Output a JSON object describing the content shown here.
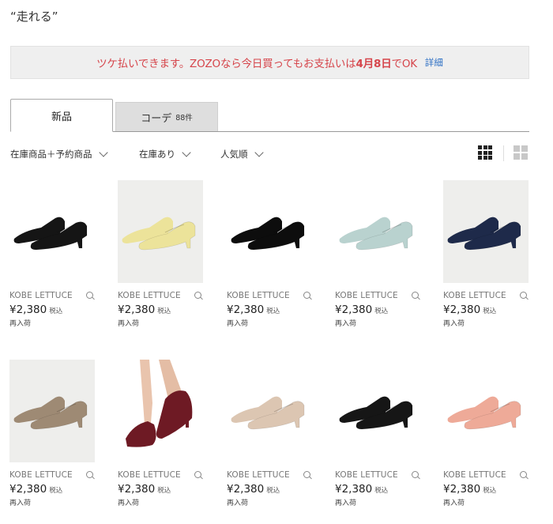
{
  "search": {
    "query": "“走れる”"
  },
  "banner": {
    "message_pre": "ツケ払いできます。ZOZOなら今日買ってもお支払いは",
    "message_bold": "4月8日",
    "message_post": "でOK",
    "more_link": "詳細"
  },
  "tabs": [
    {
      "label": "新品",
      "count": ""
    },
    {
      "label": "コーデ",
      "count": "88件"
    }
  ],
  "filters": {
    "stock_type": "在庫商品＋予約商品",
    "availability": "在庫あり",
    "sort": "人気順"
  },
  "view_icons": [
    "grid-3col-icon",
    "grid-2col-icon"
  ],
  "products": [
    {
      "brand": "KOBE LETTUCE",
      "price": "¥2,380",
      "tax": "税込",
      "note": "再入荷",
      "color": "#151515",
      "bg": "white"
    },
    {
      "brand": "KOBE LETTUCE",
      "price": "¥2,380",
      "tax": "税込",
      "note": "再入荷",
      "color": "#ece39a",
      "bg": "grey"
    },
    {
      "brand": "KOBE LETTUCE",
      "price": "¥2,380",
      "tax": "税込",
      "note": "再入荷",
      "color": "#0d0d0d",
      "bg": "white"
    },
    {
      "brand": "KOBE LETTUCE",
      "price": "¥2,380",
      "tax": "税込",
      "note": "再入荷",
      "color": "#b9d2cf",
      "bg": "white"
    },
    {
      "brand": "KOBE LETTUCE",
      "price": "¥2,380",
      "tax": "税込",
      "note": "再入荷",
      "color": "#1e2a4a",
      "bg": "grey"
    },
    {
      "brand": "KOBE LETTUCE",
      "price": "¥2,380",
      "tax": "税込",
      "note": "再入荷",
      "color": "#9e8a74",
      "bg": "grey"
    },
    {
      "brand": "KOBE LETTUCE",
      "price": "¥2,380",
      "tax": "税込",
      "note": "再入荷",
      "color": "#6e1a24",
      "bg": "white"
    },
    {
      "brand": "KOBE LETTUCE",
      "price": "¥2,380",
      "tax": "税込",
      "note": "再入荷",
      "color": "#dcc6b2",
      "bg": "white"
    },
    {
      "brand": "KOBE LETTUCE",
      "price": "¥2,380",
      "tax": "税込",
      "note": "再入荷",
      "color": "#161616",
      "bg": "white"
    },
    {
      "brand": "KOBE LETTUCE",
      "price": "¥2,380",
      "tax": "税込",
      "note": "再入荷",
      "color": "#eeaa98",
      "bg": "white"
    }
  ]
}
